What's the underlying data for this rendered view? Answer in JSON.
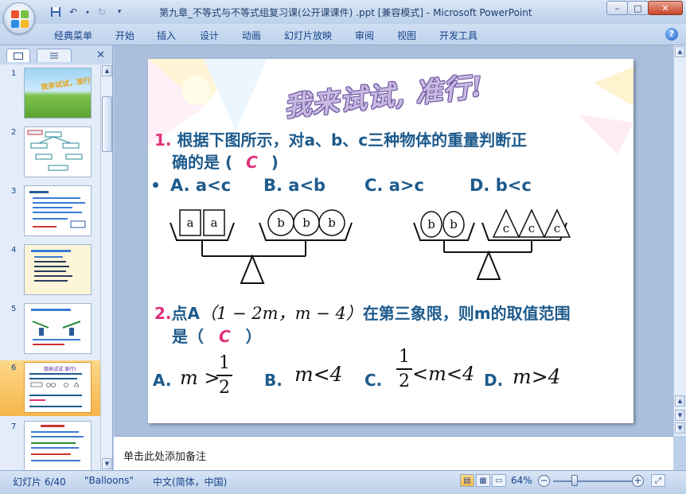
{
  "window": {
    "title": "第九章_不等式与不等式组复习课(公开课课件) .ppt [兼容模式] - Microsoft PowerPoint",
    "min": "–",
    "max": "□",
    "close": "✕"
  },
  "ribbon": {
    "tabs": [
      "经典菜单",
      "开始",
      "插入",
      "设计",
      "动画",
      "幻灯片放映",
      "审阅",
      "视图",
      "开发工具"
    ],
    "help": "?"
  },
  "thumbnails": {
    "numbers": [
      "1",
      "2",
      "3",
      "4",
      "5",
      "6",
      "7"
    ],
    "selected_index": 6,
    "slide1_caption": "我来试试，准行!",
    "slide6_caption": "我来试试 准行!"
  },
  "slide": {
    "title": "我来试试, 准行!",
    "q1": {
      "num": "1.",
      "line1": "根据下图所示，对a、b、c三种物体的重量判断正",
      "line2_pre": "确的是 (",
      "answer": "C",
      "line2_post": ")"
    },
    "q1_options": {
      "a": "A. a<c",
      "b": "B. a<b",
      "c": "C. a>c",
      "d": "D. b<c"
    },
    "scale_labels": {
      "a": "a",
      "b": "b",
      "c": "c"
    },
    "q2": {
      "num": "2.",
      "pre": "点A",
      "coords": "（1 − 2m，m − 4）",
      "post": "在第三象限，则m的取值范围",
      "line2_pre": "是（",
      "answer": "C",
      "line2_post": "）"
    },
    "q2_options": {
      "a_label": "A.",
      "a_math": "m >",
      "a_num": "1",
      "a_den": "2",
      "b_label": "B.",
      "b_math": "m<4",
      "c_label": "C.",
      "c_num": "1",
      "c_den": "2",
      "c_math": "<m<4",
      "d_label": "D.",
      "d_math": "m>4"
    }
  },
  "notes": {
    "placeholder": "单击此处添加备注"
  },
  "status": {
    "slide_info": "幻灯片 6/40",
    "theme": "\"Balloons\"",
    "language": "中文(简体，中国)",
    "zoom": "64%"
  }
}
